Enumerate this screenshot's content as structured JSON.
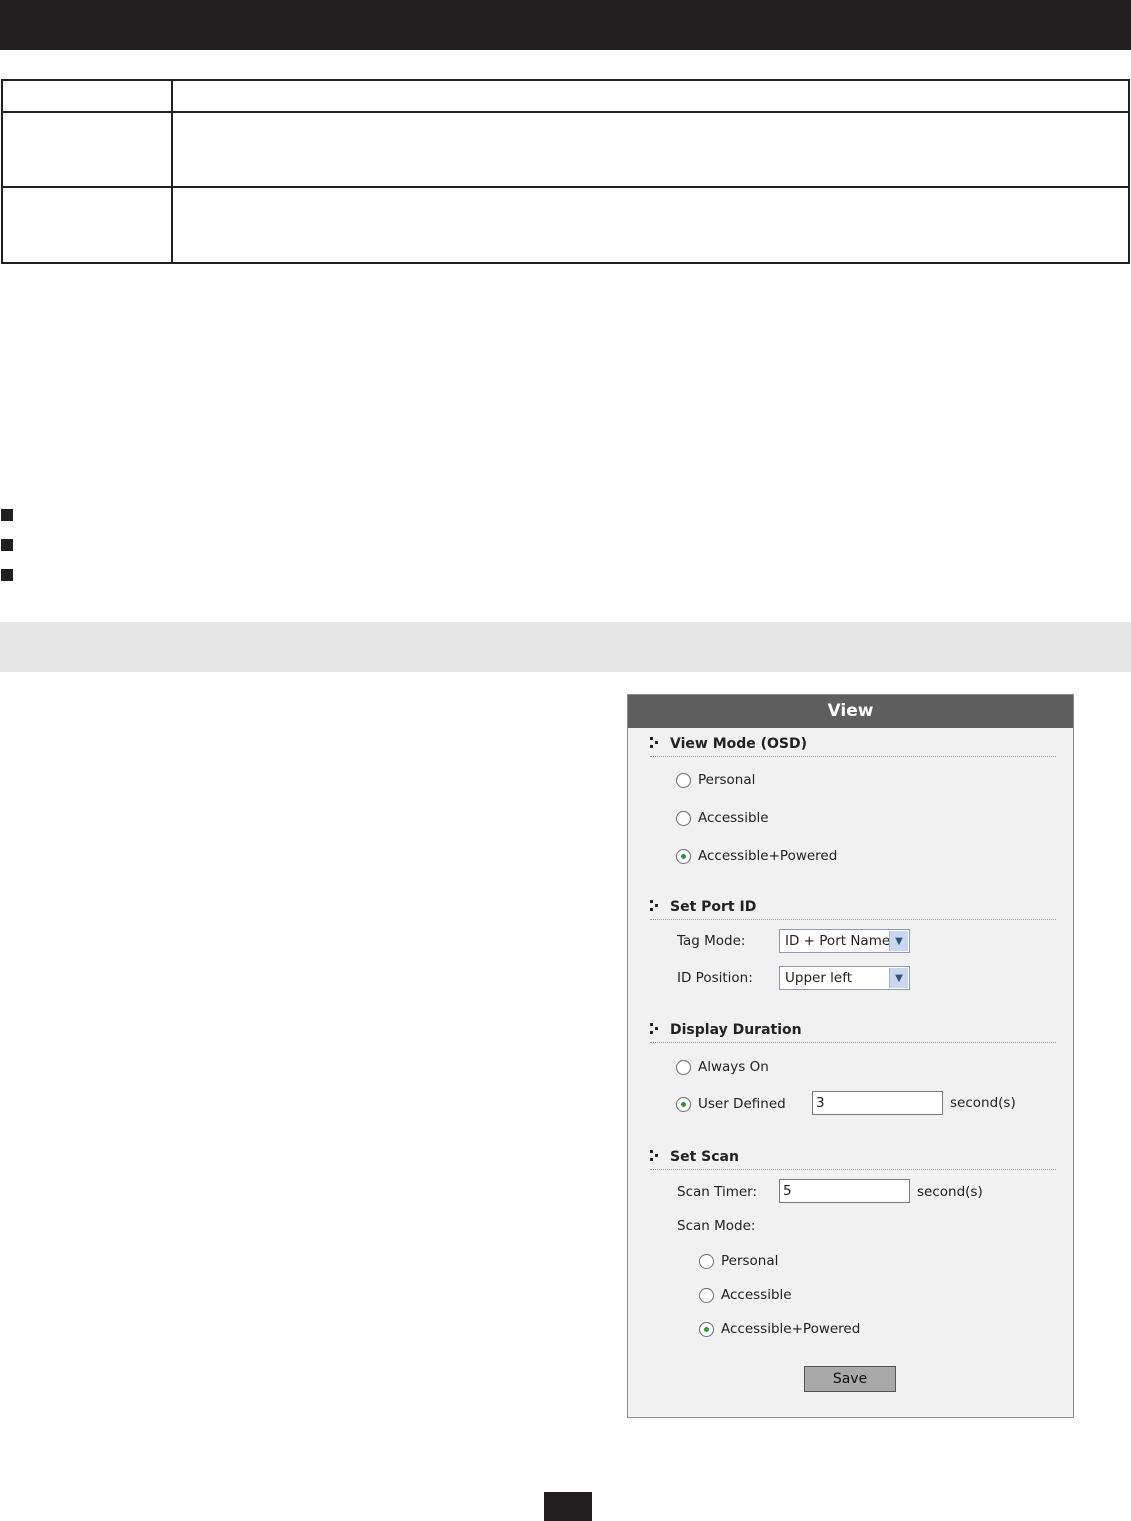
{
  "panel": {
    "title": "View",
    "view_mode": {
      "title": "View Mode (OSD)",
      "options": [
        {
          "label": "Personal",
          "checked": false
        },
        {
          "label": "Accessible",
          "checked": false
        },
        {
          "label": "Accessible+Powered",
          "checked": true
        }
      ]
    },
    "set_port_id": {
      "title": "Set Port ID",
      "tag_mode_label": "Tag Mode:",
      "tag_mode_value": "ID + Port Name",
      "id_position_label": "ID Position:",
      "id_position_value": "Upper left"
    },
    "display_duration": {
      "title": "Display Duration",
      "always_on_label": "Always On",
      "user_defined_label": "User Defined",
      "user_defined_value": "3",
      "unit": "second(s)",
      "selected": "User Defined"
    },
    "set_scan": {
      "title": "Set Scan",
      "scan_timer_label": "Scan Timer:",
      "scan_timer_value": "5",
      "unit": "second(s)",
      "scan_mode_label": "Scan Mode:",
      "options": [
        {
          "label": "Personal",
          "checked": false
        },
        {
          "label": "Accessible",
          "checked": false
        },
        {
          "label": "Accessible+Powered",
          "checked": true
        }
      ]
    },
    "save_label": "Save"
  }
}
